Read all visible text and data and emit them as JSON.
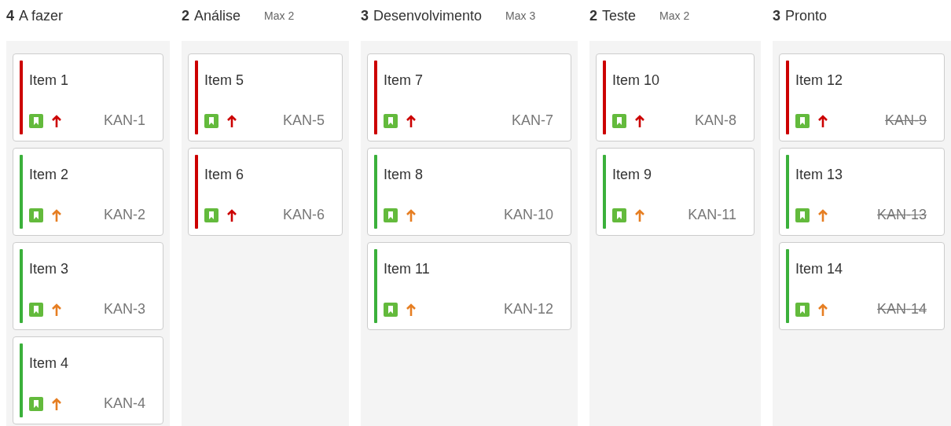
{
  "columns": [
    {
      "count": "4",
      "title": "A fazer",
      "cards": [
        {
          "title": "Item 1",
          "color": "#cc0000",
          "kind": "high",
          "key": "KAN-1",
          "done": false
        },
        {
          "title": "Item 2",
          "color": "#3bb03b",
          "kind": "medium",
          "key": "KAN-2",
          "done": false
        },
        {
          "title": "Item 3",
          "color": "#3bb03b",
          "kind": "medium",
          "key": "KAN-3",
          "done": false
        },
        {
          "title": "Item 4",
          "color": "#3bb03b",
          "kind": "medium",
          "key": "KAN-4",
          "done": false
        }
      ]
    },
    {
      "count": "2",
      "title": "Análise",
      "limit": "Max 2",
      "cards": [
        {
          "title": "Item 5",
          "color": "#cc0000",
          "kind": "high",
          "key": "KAN-5",
          "done": false
        },
        {
          "title": "Item 6",
          "color": "#cc0000",
          "kind": "high",
          "key": "KAN-6",
          "done": false
        }
      ]
    },
    {
      "count": "3",
      "title": "Desenvolvimento",
      "limit": "Max 3",
      "cards": [
        {
          "title": "Item 7",
          "color": "#cc0000",
          "kind": "high",
          "key": "KAN-7",
          "done": false
        },
        {
          "title": "Item 8",
          "color": "#3bb03b",
          "kind": "medium",
          "key": "KAN-10",
          "done": false
        },
        {
          "title": "Item 11",
          "color": "#3bb03b",
          "kind": "medium",
          "key": "KAN-12",
          "done": false
        }
      ]
    },
    {
      "count": "2",
      "title": "Teste",
      "limit": "Max 2",
      "cards": [
        {
          "title": "Item 10",
          "color": "#cc0000",
          "kind": "high",
          "key": "KAN-8",
          "done": false
        },
        {
          "title": "Item 9",
          "color": "#3bb03b",
          "kind": "medium",
          "key": "KAN-11",
          "done": false
        }
      ]
    },
    {
      "count": "3",
      "title": "Pronto",
      "cards": [
        {
          "title": "Item 12",
          "color": "#cc0000",
          "kind": "high",
          "key": "KAN-9",
          "done": true
        },
        {
          "title": "Item 13",
          "color": "#3bb03b",
          "kind": "medium",
          "key": "KAN-13",
          "done": true
        },
        {
          "title": "Item 14",
          "color": "#3bb03b",
          "kind": "medium",
          "key": "KAN-14",
          "done": true
        }
      ]
    }
  ]
}
